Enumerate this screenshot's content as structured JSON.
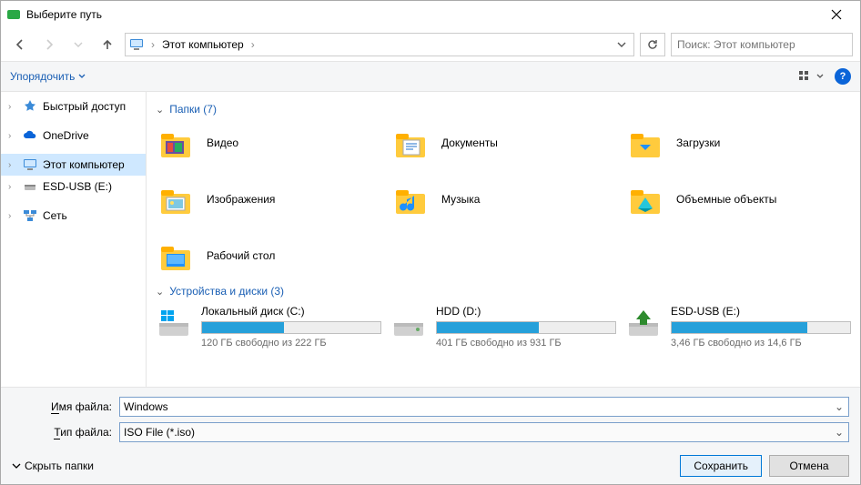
{
  "title": "Выберите путь",
  "breadcrumb": {
    "label": "Этот компьютер"
  },
  "search": {
    "placeholder": "Поиск: Этот компьютер"
  },
  "toolbar": {
    "organize": "Упорядочить"
  },
  "sidebar": {
    "items": [
      {
        "label": "Быстрый доступ",
        "icon": "star"
      },
      {
        "label": "OneDrive",
        "icon": "cloud"
      },
      {
        "label": "Этот компьютер",
        "icon": "pc",
        "selected": true
      },
      {
        "label": "ESD-USB (E:)",
        "icon": "usb"
      },
      {
        "label": "Сеть",
        "icon": "network"
      }
    ]
  },
  "groups": {
    "folders": {
      "title": "Папки (7)"
    },
    "drives": {
      "title": "Устройства и диски (3)"
    }
  },
  "folders": [
    {
      "label": "Видео"
    },
    {
      "label": "Документы"
    },
    {
      "label": "Загрузки"
    },
    {
      "label": "Изображения"
    },
    {
      "label": "Музыка"
    },
    {
      "label": "Объемные объекты"
    },
    {
      "label": "Рабочий стол"
    }
  ],
  "drives": [
    {
      "name": "Локальный диск (C:)",
      "free": "120 ГБ свободно из 222 ГБ",
      "fill_pct": 46
    },
    {
      "name": "HDD (D:)",
      "free": "401 ГБ свободно из 931 ГБ",
      "fill_pct": 57
    },
    {
      "name": "ESD-USB (E:)",
      "free": "3,46 ГБ свободно из 14,6 ГБ",
      "fill_pct": 76
    }
  ],
  "footer": {
    "filename_label_u": "И",
    "filename_label_rest": "мя файла:",
    "filetype_label_u": "Т",
    "filetype_label_rest": "ип файла:",
    "filename_value": "Windows",
    "filetype_value": "ISO File (*.iso)",
    "hide_folders": "Скрыть папки",
    "save": "Сохранить",
    "cancel": "Отмена"
  }
}
